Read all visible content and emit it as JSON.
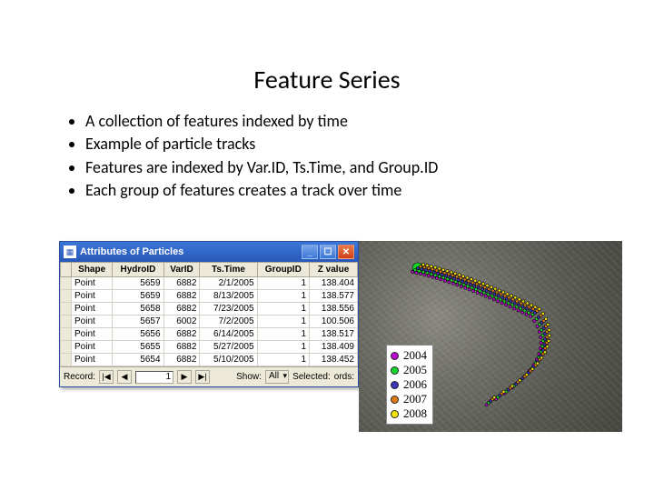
{
  "title": "Feature Series",
  "bullets": [
    "A collection of features indexed by time",
    "Example of particle tracks",
    "Features are indexed by Var.ID, Ts.Time, and Group.ID",
    "Each group of features creates a track over time"
  ],
  "win": {
    "title": "Attributes of Particles",
    "columns": [
      "Shape",
      "HydroID",
      "VarID",
      "Ts.Time",
      "GroupID",
      "Z value"
    ],
    "rows": [
      [
        "Point",
        "5659",
        "6882",
        "2/1/2005",
        "1",
        "138.404"
      ],
      [
        "Point",
        "5659",
        "6882",
        "8/13/2005",
        "1",
        "138.577"
      ],
      [
        "Point",
        "5658",
        "6882",
        "7/23/2005",
        "1",
        "138.556"
      ],
      [
        "Point",
        "5657",
        "6002",
        "7/2/2005",
        "1",
        "100.506"
      ],
      [
        "Point",
        "5656",
        "6882",
        "6/14/2005",
        "1",
        "138.517"
      ],
      [
        "Point",
        "5655",
        "6882",
        "5/27/2005",
        "1",
        "138.409"
      ],
      [
        "Point",
        "5654",
        "6882",
        "5/10/2005",
        "1",
        "138.452"
      ]
    ],
    "nav": {
      "record_label": "Record:",
      "first": "|◀",
      "prev": "◀",
      "value": "1",
      "next": "▶",
      "last": "▶|",
      "show_label": "Show:",
      "show_value": "All",
      "selected_label": "Selected:",
      "selected_value": "ords:"
    }
  },
  "legend": [
    {
      "year": "2004",
      "color": "#b909d1"
    },
    {
      "year": "2005",
      "color": "#19d62a"
    },
    {
      "year": "2006",
      "color": "#3a34b8"
    },
    {
      "year": "2007",
      "color": "#e07c14"
    },
    {
      "year": "2008",
      "color": "#f2e40a"
    }
  ]
}
